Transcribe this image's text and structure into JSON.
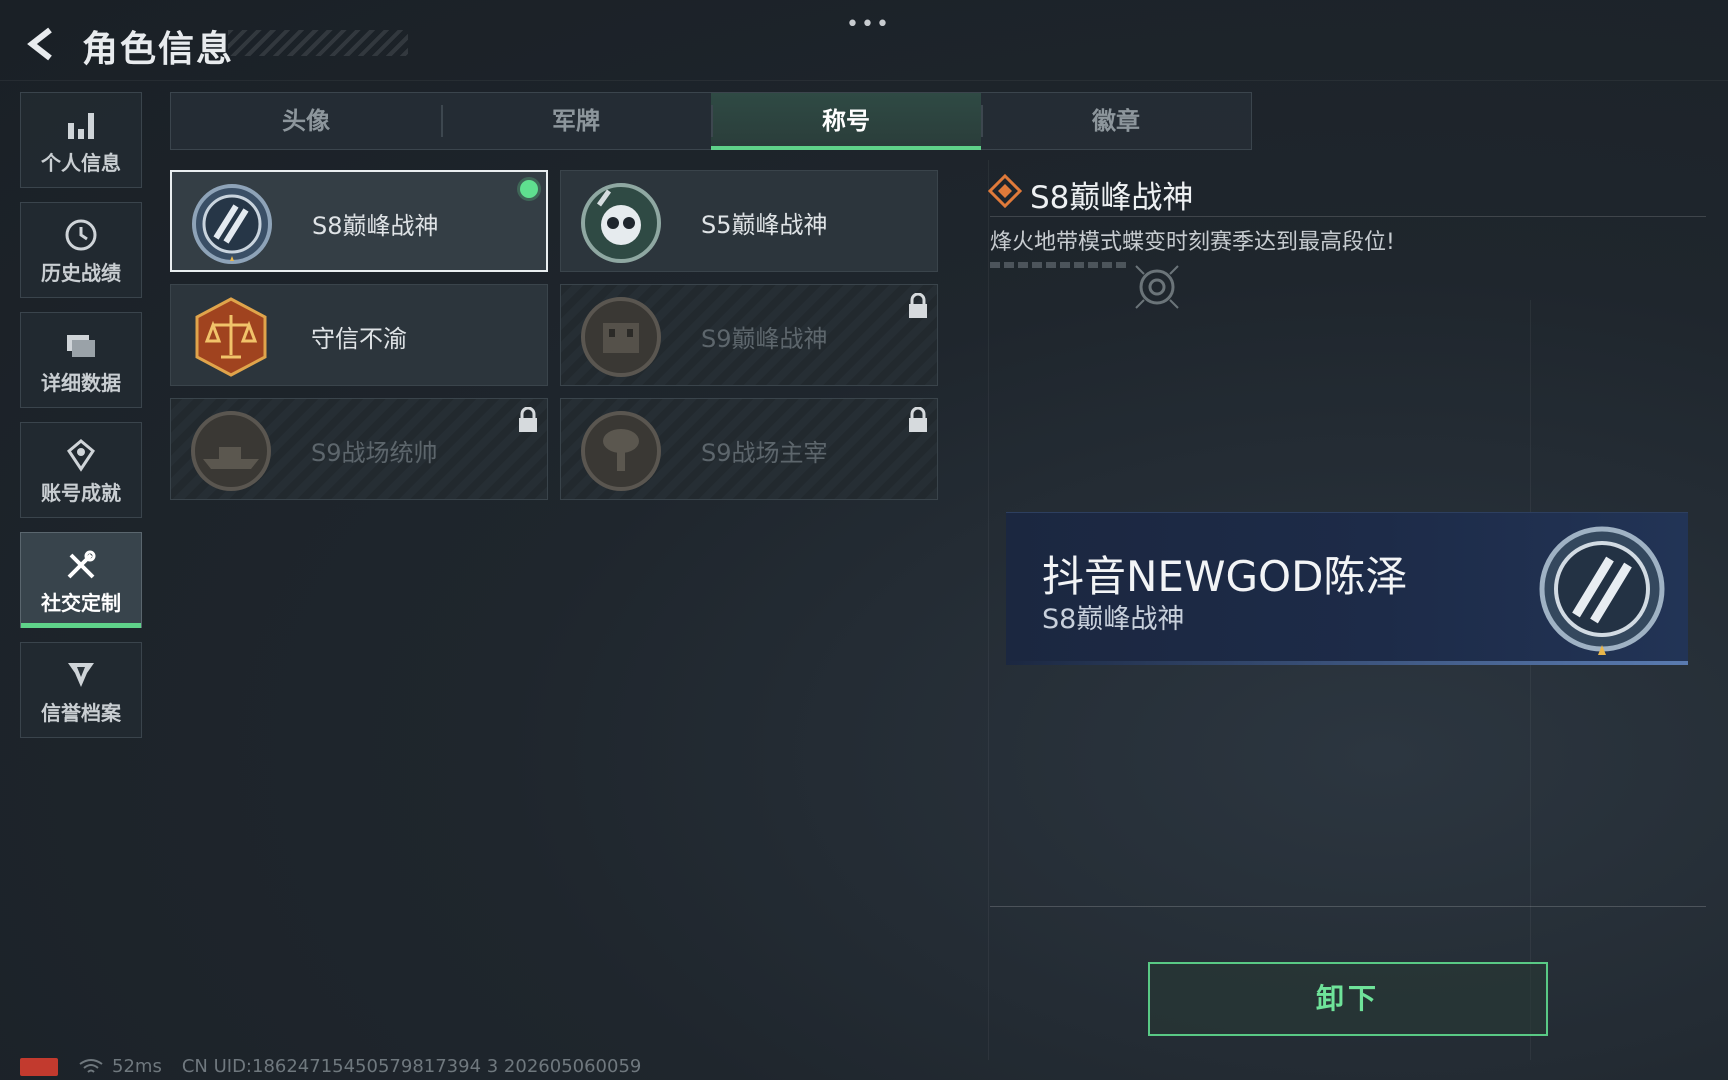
{
  "header": {
    "title": "角色信息"
  },
  "sidebar": {
    "items": [
      {
        "label": "个人信息",
        "icon": "bar-chart-icon"
      },
      {
        "label": "历史战绩",
        "icon": "clock-icon"
      },
      {
        "label": "详细数据",
        "icon": "folder-icon"
      },
      {
        "label": "账号成就",
        "icon": "achievement-icon"
      },
      {
        "label": "社交定制",
        "icon": "tools-icon",
        "active": true
      },
      {
        "label": "信誉档案",
        "icon": "shield-badge-icon"
      }
    ]
  },
  "tabs": [
    {
      "label": "头像"
    },
    {
      "label": "军牌"
    },
    {
      "label": "称号",
      "active": true
    },
    {
      "label": "徽章"
    }
  ],
  "titles": [
    {
      "name": "S8巅峰战神",
      "state": "equipped"
    },
    {
      "name": "S5巅峰战神",
      "state": "unlocked"
    },
    {
      "name": "守信不渝",
      "state": "unlocked"
    },
    {
      "name": "S9巅峰战神",
      "state": "locked"
    },
    {
      "name": "S9战场统帅",
      "state": "locked"
    },
    {
      "name": "S9战场主宰",
      "state": "locked"
    }
  ],
  "detail": {
    "title": "S8巅峰战神",
    "description": "烽火地带模式蝶变时刻赛季达到最高段位!"
  },
  "nameplate": {
    "player_name": "抖音NEWGOD陈泽",
    "title": "S8巅峰战神"
  },
  "actions": {
    "unequip_label": "卸下"
  },
  "status_bar": {
    "ping": "52ms",
    "uid": "CN UID:18624715450579817394 3 202605060059"
  },
  "colors": {
    "accent": "#5fd38a",
    "plate_bg": "#1d2b48",
    "title_icon": "#e07a3a"
  }
}
